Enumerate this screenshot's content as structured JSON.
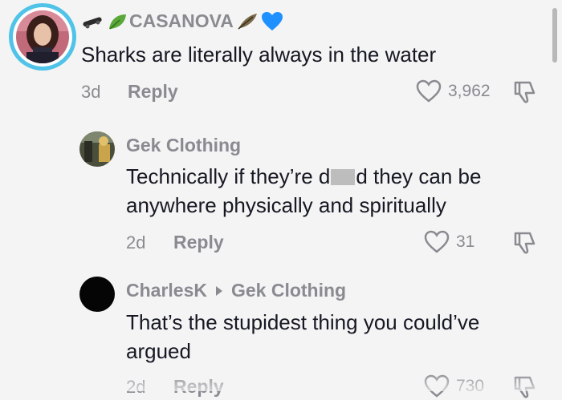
{
  "comments": [
    {
      "username": "CASANOVA",
      "text": "Sharks are literally always in the water",
      "age": "3d",
      "reply_label": "Reply",
      "likes": "3,962"
    },
    {
      "username": "Gek Clothing",
      "text_before": "Technically if they’re d",
      "text_after": "d they can be",
      "text_line2": "anywhere physically and spiritually",
      "age": "2d",
      "reply_label": "Reply",
      "likes": "31"
    },
    {
      "username": "CharlesK",
      "reply_to": "Gek Clothing",
      "text_line1": "That’s the stupidest thing you could’ve",
      "text_line2": "argued",
      "age": "2d",
      "reply_label": "Reply",
      "likes": "730"
    }
  ],
  "colors": {
    "background": "#f4f4f4",
    "text": "#161823",
    "secondary": "#8a8b91",
    "heart_emoji": "#1e90ff",
    "avatar_ring": "#4fc3e8"
  },
  "icons": [
    "skateboard-icon",
    "leaf-icon",
    "feather-icon",
    "blue-heart-icon",
    "heart-outline-icon",
    "dislike-icon",
    "reply-arrow-icon"
  ]
}
